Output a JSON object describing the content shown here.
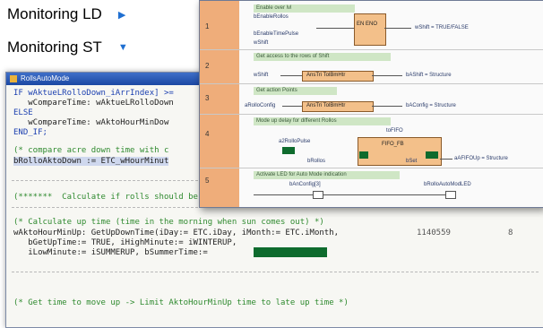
{
  "nav": {
    "link1": "Monitoring LD",
    "link2": "Monitoring ST"
  },
  "st_window": {
    "title": "RollsAutoMode",
    "lines": [
      "IF wAktueLRolloDown_iArrIndex] >=",
      "   wCompareTime: wAktueLRolloDown",
      "ELSE",
      "   wCompareTime: wAktoHourMinDow",
      "END_IF;",
      "(* compare acre down time with c",
      "bRolloAktoDown := ETC_wHourMinut",
      "(*******  Calculate if rolls should be moved up  *******)",
      "(* Calculate up time (time in the morning when sun comes out) *)",
      "wAktoHourMinUp: GetUpDownTime(iDay:= ETC.iDay, iMonth:= ETC.iMonth,",
      "   bGetUpTime:= TRUE, iHighMinute:= iWINTERUP,",
      "   iLowMinute:= iSUMMERUP, bSummerTime:=",
      "(* Get time to move up -> Limit AktoHourMinUp time to late up time *)"
    ],
    "right_values": [
      "1140559",
      "8"
    ]
  },
  "fbd_window": {
    "networks": [
      {
        "num": "1",
        "comment": "Enable over lvl"
      },
      {
        "num": "2",
        "comment": "Get access to the rows of Shift"
      },
      {
        "num": "3",
        "comment": "Get action Points"
      },
      {
        "num": "4",
        "comment": "Mode up delay for different Rollos"
      },
      {
        "num": "5",
        "comment": "Activate LED for Auto Mode indication"
      }
    ],
    "labels": {
      "n1_in1": "bEnableRollos",
      "n1_in2": "bEnableTimePulse",
      "n1_in3": "wShift",
      "n1_blk": "EN  ENO",
      "n1_out": "wShift = TRUE/FALSE",
      "n2_in": "wShift",
      "n2_blk": "AnsTri  TolBmHtr",
      "n2_out": "bAShift = Structure",
      "n3_in": "aRolloConfig",
      "n3_blk": "AnsTri  TolBmHtr",
      "n3_out": "bAConfig = Structure",
      "n4_top": "toFIFO",
      "n4_blk": "FIFO_FB",
      "n4_in": "a2RolloPulse",
      "n4_in2": "bRollos",
      "n4_out": "aAFIFOUp = Structure",
      "n4_lbl": "bSet",
      "n5_in": "bAnConfig[3]",
      "n5_out": "bRolloAutoModLED"
    }
  }
}
